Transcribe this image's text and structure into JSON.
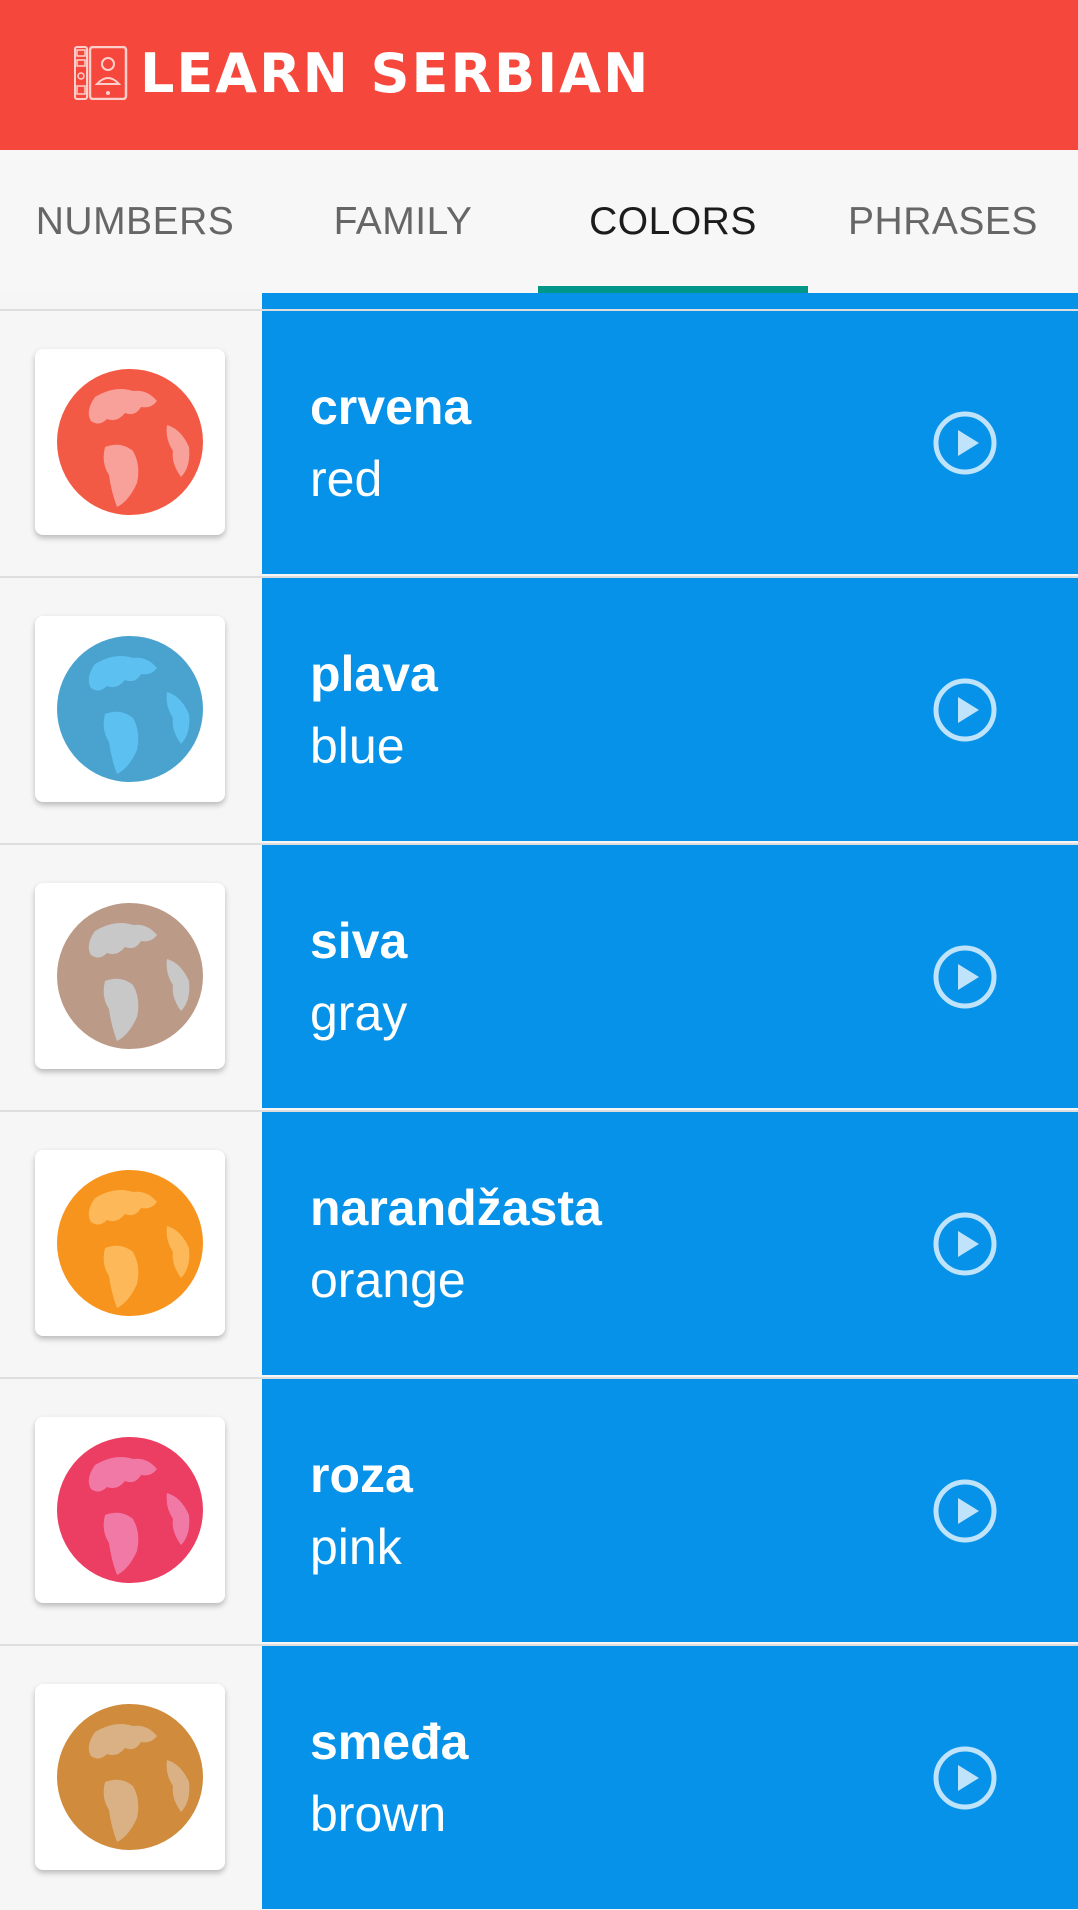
{
  "app": {
    "title": "LEARN SERBIAN"
  },
  "tabs": [
    {
      "label": "NUMBERS",
      "active": false
    },
    {
      "label": "FAMILY",
      "active": false
    },
    {
      "label": "COLORS",
      "active": true
    },
    {
      "label": "PHRASES",
      "active": false
    }
  ],
  "items": [
    {
      "word": "crvena",
      "translation": "red",
      "globe_color": "#f35a45",
      "land_color": "#f8a09a"
    },
    {
      "word": "plava",
      "translation": "blue",
      "globe_color": "#4aa3cf",
      "land_color": "#5cc0f0"
    },
    {
      "word": "siva",
      "translation": "gray",
      "globe_color": "#bb9a88",
      "land_color": "#c8c8c8"
    },
    {
      "word": "narandžasta",
      "translation": "orange",
      "globe_color": "#f7941d",
      "land_color": "#fdb959"
    },
    {
      "word": "roza",
      "translation": "pink",
      "globe_color": "#ec3d63",
      "land_color": "#f07aa5"
    },
    {
      "word": "smeđa",
      "translation": "brown",
      "globe_color": "#d08b3c",
      "land_color": "#d9b184"
    }
  ],
  "colors": {
    "header": "#f5473b",
    "panel": "#0592e8",
    "tab_indicator": "#009688"
  },
  "icons": {
    "logo": "phone-learning-icon",
    "play": "play-circle-icon",
    "globe": "globe-icon"
  }
}
